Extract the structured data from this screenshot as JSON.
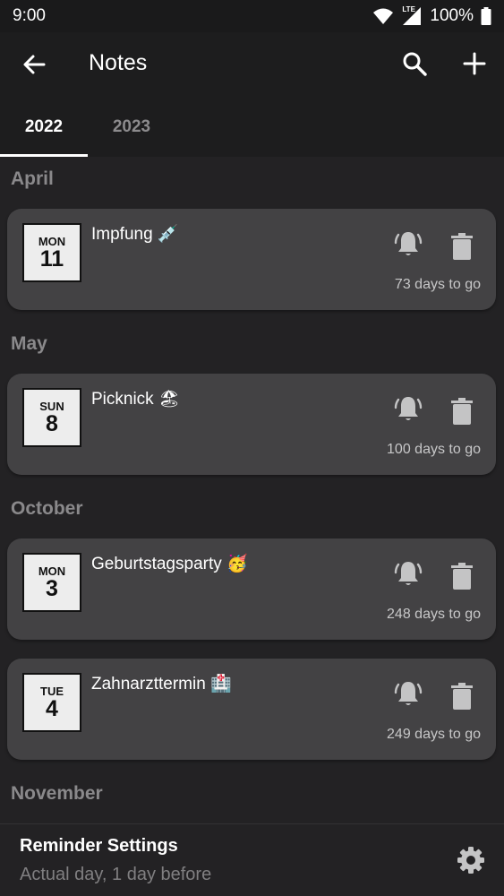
{
  "status_bar": {
    "time": "9:00",
    "network": "LTE",
    "battery": "100%"
  },
  "app_bar": {
    "title": "Notes",
    "back_icon": "arrow-back-icon",
    "search_icon": "search-icon",
    "add_icon": "plus-icon"
  },
  "tabs": [
    {
      "label": "2022",
      "active": true
    },
    {
      "label": "2023",
      "active": false
    }
  ],
  "sections": [
    {
      "month": "April",
      "notes": [
        {
          "weekday": "MON",
          "day": "11",
          "title": "Impfung 💉",
          "days_left": "73 days to go"
        }
      ]
    },
    {
      "month": "May",
      "notes": [
        {
          "weekday": "SUN",
          "day": "8",
          "title": "Picknick 🏖",
          "days_left": "100 days to go"
        }
      ]
    },
    {
      "month": "October",
      "notes": [
        {
          "weekday": "MON",
          "day": "3",
          "title": "Geburtstagsparty 🥳",
          "days_left": "248 days to go"
        },
        {
          "weekday": "TUE",
          "day": "4",
          "title": "Zahnarzttermin 🏥",
          "days_left": "249 days to go"
        }
      ]
    },
    {
      "month": "November",
      "notes": []
    }
  ],
  "reminder_settings": {
    "title": "Reminder Settings",
    "value": "Actual day, 1 day before"
  },
  "colors": {
    "background": "#232224",
    "card": "#434244",
    "app_bar": "#1d1d1e",
    "muted_text": "#8a898b"
  }
}
